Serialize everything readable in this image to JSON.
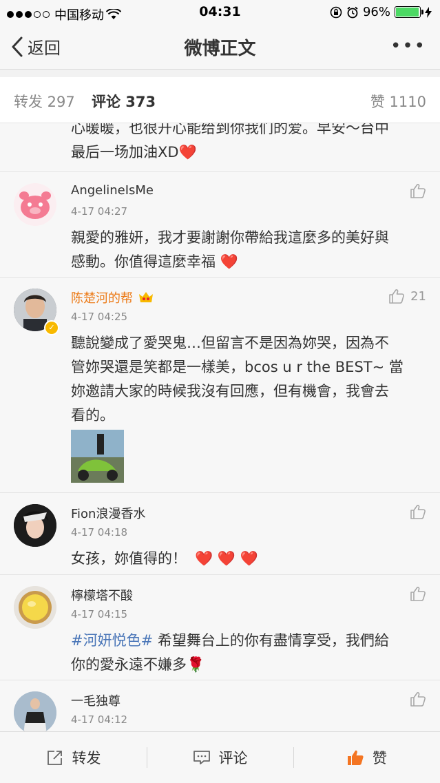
{
  "status_bar": {
    "carrier": "中国移动",
    "time": "04:31",
    "battery_text": "96%",
    "battery_level": 0.96
  },
  "nav": {
    "back_label": "返回",
    "title": "微博正文"
  },
  "tabs": {
    "repost": "转发 297",
    "comment": "评论 373",
    "like": "赞 1110"
  },
  "comments": [
    {
      "text_lines": [
        "心暖暖，也很开心能给到你我们的爱。早安～台中",
        "最后一场加油XD"
      ],
      "emoji": "❤️"
    },
    {
      "username": "AngelineIsMe",
      "time": "4-17 04:27",
      "text_lines": [
        "親愛的雅妍，我才要謝謝你帶給我這麼多的美好與",
        "感動。你值得這麼幸福 "
      ],
      "emoji": "❤️"
    },
    {
      "username": "陈楚河的帮",
      "time": "4-17 04:25",
      "likes": "21",
      "text_lines": [
        "聽說變成了愛哭鬼…但留言不是因為妳哭，因為不",
        "管妳哭還是笑都是一樣美，bcos u r the BEST~ 當",
        "妳邀請大家的時候我沒有回應，但有機會，我會去",
        "看的。"
      ]
    },
    {
      "username": "Fion浪漫香水",
      "time": "4-17 04:18",
      "text": "女孩，妳值得的！",
      "emoji": "❤️ ❤️ ❤️"
    },
    {
      "username": "檸檬塔不酸",
      "time": "4-17 04:15",
      "topic": "#河妍悦色#",
      "text_lines": [
        " 希望舞台上的你有盡情享受，我們給",
        "你的愛永遠不嫌多"
      ],
      "emoji": "🌹"
    },
    {
      "username": "一毛独尊",
      "time": "4-17 04:12"
    }
  ],
  "bottom_bar": {
    "repost": "转发",
    "comment": "评论",
    "like": "赞"
  },
  "colors": {
    "accent": "#f79324",
    "username_orange": "#ec7a16",
    "topic_blue": "#4a76b8",
    "heart_red": "#e8212e"
  }
}
